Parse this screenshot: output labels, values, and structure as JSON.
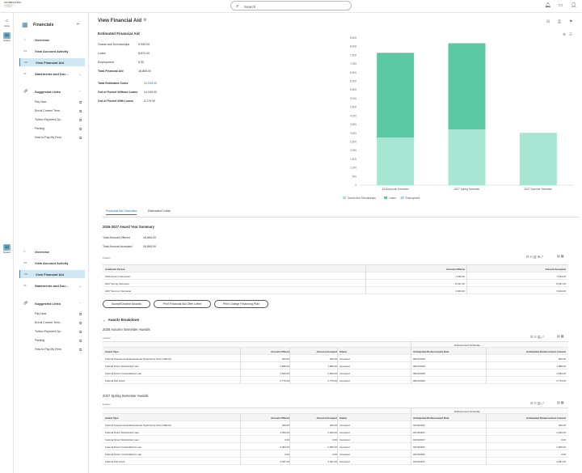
{
  "brand": {
    "name": "COLUMBUS STATE",
    "sub": "COMMUNITY COLLEGE"
  },
  "search": {
    "placeholder": "Search"
  },
  "rail": {
    "home": "Home",
    "student": "Student",
    "student2": "Student"
  },
  "nav": {
    "title": "Financials",
    "items": [
      {
        "label": "Overview"
      },
      {
        "label": "View Account Activity"
      },
      {
        "label": "View Financial Aid"
      },
      {
        "label": "Statements and Doc..."
      }
    ],
    "suggested_title": "Suggested Links",
    "links": [
      {
        "label": "Pay Now"
      },
      {
        "label": "Enroll Current Term..."
      },
      {
        "label": "Tuition Payment Op..."
      },
      {
        "label": "Parking"
      },
      {
        "label": "How to Pay My Fees"
      }
    ]
  },
  "page": {
    "title": "View Financial Aid",
    "section_title": "Estimated Financial Aid",
    "summary": [
      {
        "label": "Grants and Scholarships",
        "value": "9,995.00"
      },
      {
        "label": "Loans",
        "value": "8,870.00"
      },
      {
        "label": "Employment",
        "value": "0.00"
      },
      {
        "label": "Total Financial Aid",
        "value": "18,865.00"
      }
    ],
    "totals": [
      {
        "label": "Total Estimated Costs",
        "value": "34,045.00"
      },
      {
        "label": "Out of Pocket Without Loans",
        "value": "14,049.00"
      },
      {
        "label": "Out of Pocket With Loans",
        "value": "5,179.00"
      }
    ]
  },
  "chart_data": {
    "type": "bar",
    "stacked": true,
    "categories": [
      "2026 Autumn Semester",
      "2027 Spring Semester",
      "2027 Summer Semester"
    ],
    "series": [
      {
        "name": "Grants and Scholarships",
        "color": "#a8e6d4",
        "values": [
          2750,
          3220,
          3024
        ]
      },
      {
        "name": "Loans",
        "color": "#5cc9a5",
        "values": [
          4895,
          4980,
          0
        ]
      },
      {
        "name": "Employment",
        "color": "#9fd4ec",
        "values": [
          0,
          0,
          0
        ]
      }
    ],
    "ylim": [
      0,
      8500
    ],
    "yticks": [
      "0",
      "500",
      "1,000",
      "1,500",
      "2,000",
      "2,500",
      "3,000",
      "3,500",
      "4,000",
      "4,500",
      "5,000",
      "5,500",
      "6,000",
      "6,500",
      "7,000",
      "7,500",
      "8,000",
      "8,500"
    ],
    "legend": "bottom-left",
    "grid": false
  },
  "tabs": [
    {
      "label": "Financial Aid Overview"
    },
    {
      "label": "Estimated Costs"
    }
  ],
  "year_summary": {
    "title": "2026-2027 Award Year Summary",
    "offered_label": "Total Amount Offered",
    "offered": "18,865.00",
    "accepted_label": "Total Amount Accepted",
    "accepted": "18,865.00",
    "items": "3 items",
    "headers": [
      "Academic Period",
      "Amount Offered",
      "Amount Accepted"
    ],
    "rows": [
      [
        "2026 Autumn Semester",
        "7,645.00",
        "7,645.00"
      ],
      [
        "2027 Spring Semester",
        "8,197.00",
        "8,197.00"
      ],
      [
        "2027 Summer Semester",
        "3,024.00",
        "3,024.00"
      ]
    ]
  },
  "buttons": {
    "accept": "Accept/Decline Awards",
    "offer": "Print Financial Aid Offer Letter",
    "plan": "Print College Financing Plan"
  },
  "breakdown": {
    "title": "Awards Breakdown",
    "disb_schedule": "Disbursement Schedule",
    "headers": [
      "Award Type",
      "Amount Offered",
      "Amount Accepted",
      "Status",
      "Anticipated Disbursement Date",
      "Anticipated Disbursement Amount"
    ],
    "groups": [
      {
        "title": "2026 Autumn Semester Awards",
        "items": "4 items",
        "rows": [
          [
            "Federal Supplemental Educational Opportunity Grant (SEOG)",
            "200.00",
            "200.00",
            "Accepted",
            "08/23/2026",
            "200.00"
          ],
          [
            "Federal Direct Subsidized Loan",
            "1,985.00",
            "1,985.00",
            "Accepted",
            "08/23/2026",
            "1,985.00"
          ],
          [
            "Federal Direct Unsubsidized Loan",
            "2,690.00",
            "2,690.00",
            "Accepted",
            "08/23/2026",
            "2,690.00"
          ],
          [
            "Federal Pell Grant",
            "2,770.00",
            "2,770.00",
            "Accepted",
            "08/23/2026",
            "2,770.00"
          ]
        ]
      },
      {
        "title": "2027 Spring Semester Awards",
        "items": "6 items",
        "rows": [
          [
            "Federal Supplemental Educational Opportunity Grant (SEOG)",
            "200.00",
            "200.00",
            "Accepted",
            "02/16/2027",
            "200.00"
          ],
          [
            "Federal Direct Subsidized Loan",
            "2,250.00",
            "2,250.00",
            "Accepted",
            "02/16/2027",
            "2,250.00"
          ],
          [
            "Federal Direct Subsidized Loan",
            "0.00",
            "0.00",
            "Canceled",
            "02/16/2027",
            "0.00"
          ],
          [
            "Federal Direct Unsubsidized Loan",
            "2,000.00",
            "2,000.00",
            "Accepted",
            "02/16/2027",
            "2,000.00"
          ],
          [
            "Federal Direct Unsubsidized Loan",
            "0.00",
            "0.00",
            "Canceled",
            "02/16/2027",
            "0.00"
          ],
          [
            "Federal Pell Grant",
            "3,497.00",
            "3,497.00",
            "Accepted",
            "02/16/2027",
            "3,497.00"
          ]
        ]
      }
    ]
  }
}
